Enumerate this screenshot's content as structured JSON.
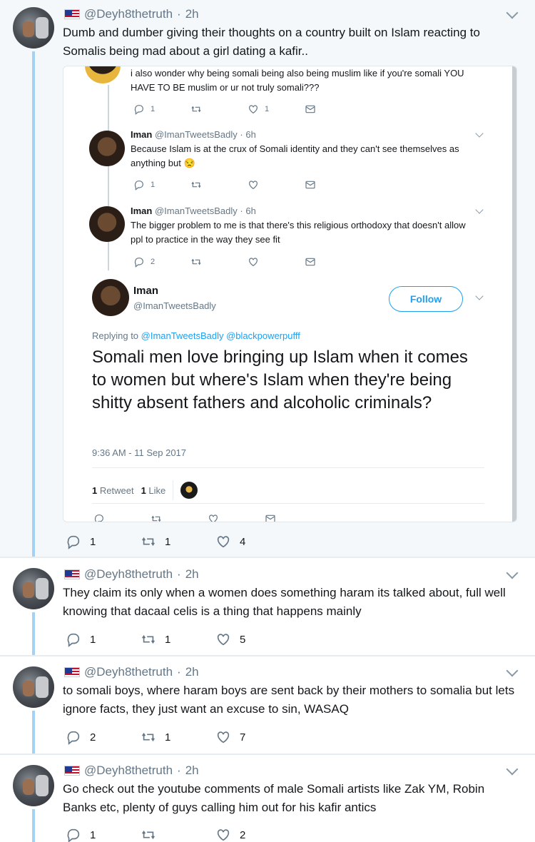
{
  "tweets": [
    {
      "handle": "@Deyh8thetruth",
      "time": "2h",
      "text": "Dumb and dumber giving their thoughts on a country built on Islam reacting to Somalis being mad about a girl dating a kafir..",
      "replies": "1",
      "retweets": "1",
      "likes": "4"
    },
    {
      "handle": "@Deyh8thetruth",
      "time": "2h",
      "text": "They claim its only when a women does something haram its talked about, full well knowing that dacaal celis is a thing that happens mainly",
      "replies": "1",
      "retweets": "1",
      "likes": "5"
    },
    {
      "handle": "@Deyh8thetruth",
      "time": "2h",
      "text": "to somali boys, where haram boys are sent back by their mothers to somalia but lets ignore facts, they just want an excuse to sin, WASAQ",
      "replies": "2",
      "retweets": "1",
      "likes": "7"
    },
    {
      "handle": "@Deyh8thetruth",
      "time": "2h",
      "text": "Go check out the youtube comments of male Somali artists like Zak YM, Robin Banks etc, plenty of guys calling him out for his kafir antics",
      "replies": "1",
      "retweets": "",
      "likes": "2"
    }
  ],
  "embed": {
    "top_text": "i also wonder why being somali being also being muslim like if you're somali YOU HAVE TO BE muslim or ur not truly somali???",
    "top_counts": {
      "replies": "1",
      "retweets": "",
      "likes": "1"
    },
    "reply1": {
      "name": "Iman",
      "handle": "@ImanTweetsBadly",
      "time": "6h",
      "text": "Because Islam is at the crux of Somali identity and they can't see themselves as anything but 😒",
      "replies": "1"
    },
    "reply2": {
      "name": "Iman",
      "handle": "@ImanTweetsBadly",
      "time": "6h",
      "text": "The bigger problem to me is that there's this religious orthodoxy that doesn't allow ppl to practice in the way they see fit",
      "replies": "2"
    },
    "main": {
      "name": "Iman",
      "handle": "@ImanTweetsBadly",
      "follow": "Follow",
      "replying_label": "Replying to",
      "replying_to": "@ImanTweetsBadly @blackpowerpufff",
      "text": "Somali men love bringing up Islam when it comes to women but where's Islam when they're being shitty absent fathers and alcoholic criminals?",
      "timestamp": "9:36 AM - 11 Sep 2017",
      "retweets_count": "1",
      "retweets_label": "Retweet",
      "likes_count": "1",
      "likes_label": "Like"
    }
  },
  "icons": {
    "reply": "reply-icon",
    "retweet": "retweet-icon",
    "like": "heart-icon",
    "dm": "envelope-icon",
    "more": "chevron-down-icon"
  },
  "colors": {
    "accent": "#1da1f2",
    "thread": "#a3d2f5",
    "muted": "#657786"
  }
}
